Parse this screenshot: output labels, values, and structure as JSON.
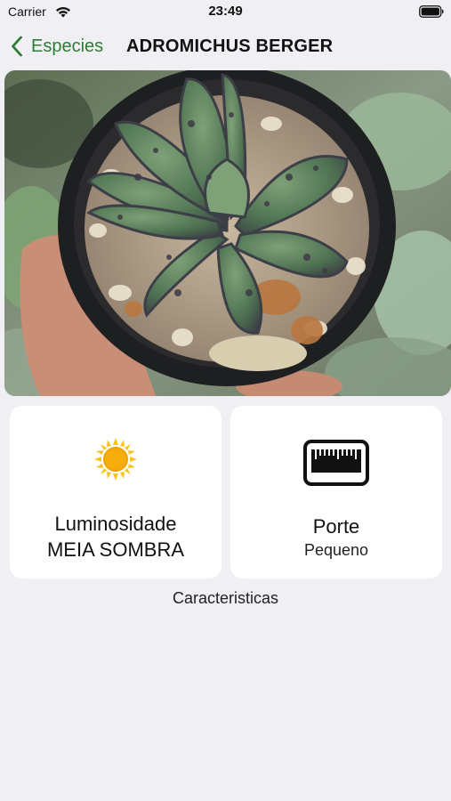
{
  "status_bar": {
    "carrier": "Carrier",
    "time": "23:49"
  },
  "nav": {
    "back_label": "Especies",
    "title": "ADROMICHUS BERGER",
    "accent_color": "#2e7d32"
  },
  "photo": {
    "subject": "potted succulent photo"
  },
  "cards": {
    "light": {
      "icon": "sun-icon",
      "title": "Luminosidade",
      "value": "MEIA SOMBRA"
    },
    "size": {
      "icon": "ruler-icon",
      "title": "Porte",
      "value": "Pequeno"
    }
  },
  "section_label": "Caracteristicas"
}
